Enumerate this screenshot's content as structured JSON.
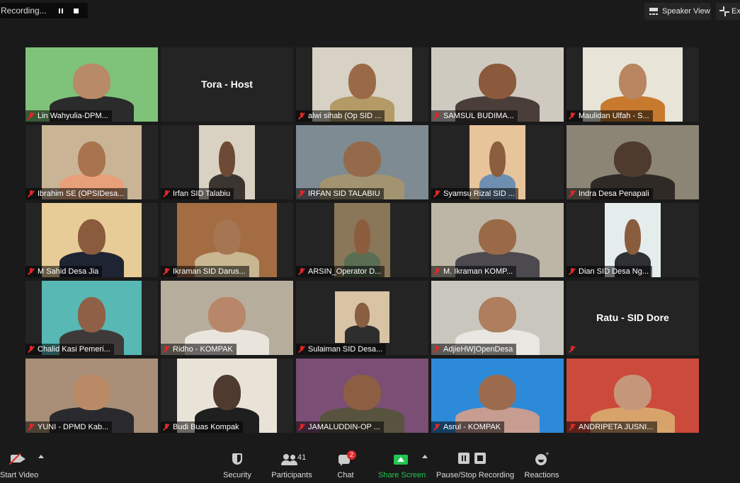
{
  "recording": {
    "label": "Recording..."
  },
  "top_bar": {
    "speaker_view": "Speaker View",
    "exit_full_screen": "Ex"
  },
  "participants": [
    {
      "name": "Lin Wahyulia-DPM...",
      "bg": "#7fc27a",
      "skin": "#b98a66",
      "shirt": "#2b2b2b",
      "style": "full",
      "active": false
    },
    {
      "name": "Tora - Host",
      "style": "blank",
      "active": false
    },
    {
      "name": "alwi sihab (Op SID ...",
      "bg": "#d7d2c4",
      "skin": "#9a6a48",
      "shirt": "#b39a66",
      "style": "mid",
      "active": false
    },
    {
      "name": "SAMSUL BUDIMA...",
      "bg": "#cfcac0",
      "skin": "#8b5a3c",
      "shirt": "#4a3e3a",
      "style": "full",
      "active": false
    },
    {
      "name": "Maulidan Ulfah - S...",
      "bg": "#e8e4d8",
      "skin": "#b88660",
      "shirt": "#c77a2d",
      "style": "mid",
      "active": false
    },
    {
      "name": "Ibrahim SE (OPSIDesa...",
      "bg": "#c9b496",
      "skin": "#a8734e",
      "shirt": "#e7a07a",
      "style": "mid",
      "active": false
    },
    {
      "name": "Irfan SID Talabiu",
      "bg": "#d9d2c2",
      "skin": "#6d4a35",
      "shirt": "#3a3531",
      "style": "narrow",
      "active": false
    },
    {
      "name": "IRFAN SID TALABIU",
      "bg": "#7e8b92",
      "skin": "#946a4b",
      "shirt": "#a29470",
      "style": "full",
      "active": false
    },
    {
      "name": "Syamsu Rizal SID ...",
      "bg": "#e8c49a",
      "skin": "#8b5e40",
      "shirt": "#6f8fb0",
      "style": "narrow",
      "active": false
    },
    {
      "name": "Indra Desa Penapali",
      "bg": "#8c8576",
      "skin": "#4f3b2e",
      "shirt": "#2f2a26",
      "style": "full",
      "active": false
    },
    {
      "name": "M Sahid Desa Jia",
      "bg": "#e7cc98",
      "skin": "#8a5c3d",
      "shirt": "#1f2433",
      "style": "mid",
      "active": false
    },
    {
      "name": "Ikraman SID Darus...",
      "bg": "#a36c43",
      "skin": "#a67552",
      "shirt": "#c8b790",
      "style": "mid",
      "active": false
    },
    {
      "name": "ARSIN_Operator D...",
      "bg": "#8a7658",
      "skin": "#8b5d3e",
      "shirt": "#596e52",
      "style": "narrow",
      "active": false
    },
    {
      "name": "M. Ikraman KOMP...",
      "bg": "#bdb5a5",
      "skin": "#9a6a48",
      "shirt": "#4d4a4f",
      "style": "full",
      "active": false
    },
    {
      "name": "Dian SID Desa Ng...",
      "bg": "#e5ecec",
      "skin": "#8a5c3e",
      "shirt": "#2f3033",
      "style": "narrow",
      "active": false
    },
    {
      "name": "Chalid Kasi Pemeri...",
      "bg": "#57b8b4",
      "skin": "#8f6045",
      "shirt": "#3e3a39",
      "style": "mid",
      "active": false
    },
    {
      "name": "Ridho - KOMPAK",
      "bg": "#b7ad9c",
      "skin": "#b8876a",
      "shirt": "#e9e5dd",
      "style": "full",
      "active": false
    },
    {
      "name": "Sulaiman SID Desa...",
      "bg": "#d8c3a5",
      "skin": "#8a5e41",
      "shirt": "#2e2e2e",
      "style": "box",
      "active": false
    },
    {
      "name": "AdjieHW|OpenDesa",
      "bg": "#c9c6bd",
      "skin": "#ae7e5e",
      "shirt": "#e8e7e2",
      "style": "full",
      "active": true
    },
    {
      "name": "Ratu - SID Dore",
      "style": "blank",
      "active": false
    },
    {
      "name": "YUNI - DPMD Kab...",
      "bg": "#a88e76",
      "skin": "#ba8a66",
      "shirt": "#2a2a2e",
      "style": "full",
      "active": false
    },
    {
      "name": "Budi Buas Kompak",
      "bg": "#e9e3d7",
      "skin": "#4f3a2f",
      "shirt": "#1f1f20",
      "style": "mid",
      "active": false
    },
    {
      "name": "JAMALUDDIN-OP ...",
      "bg": "#7a4e75",
      "skin": "#8d5f42",
      "shirt": "#58533f",
      "style": "full",
      "active": false
    },
    {
      "name": "Asrul - KOMPAK",
      "bg": "#2d8ad8",
      "skin": "#9c6a4c",
      "shirt": "#c79c91",
      "style": "full",
      "active": false
    },
    {
      "name": "ANDRIPETA JUSNI...",
      "bg": "#cc4a3c",
      "skin": "#c5977a",
      "shirt": "#d8a36a",
      "style": "full",
      "active": false
    }
  ],
  "toolbar": {
    "start_video": "Start Video",
    "security": "Security",
    "participants": "Participants",
    "participants_count": "41",
    "chat": "Chat",
    "chat_badge": "2",
    "share_screen": "Share Screen",
    "pause_stop_recording": "Pause/Stop Recording",
    "reactions": "Reactions",
    "share_color": "#23c552",
    "badge_color": "#e02828"
  }
}
